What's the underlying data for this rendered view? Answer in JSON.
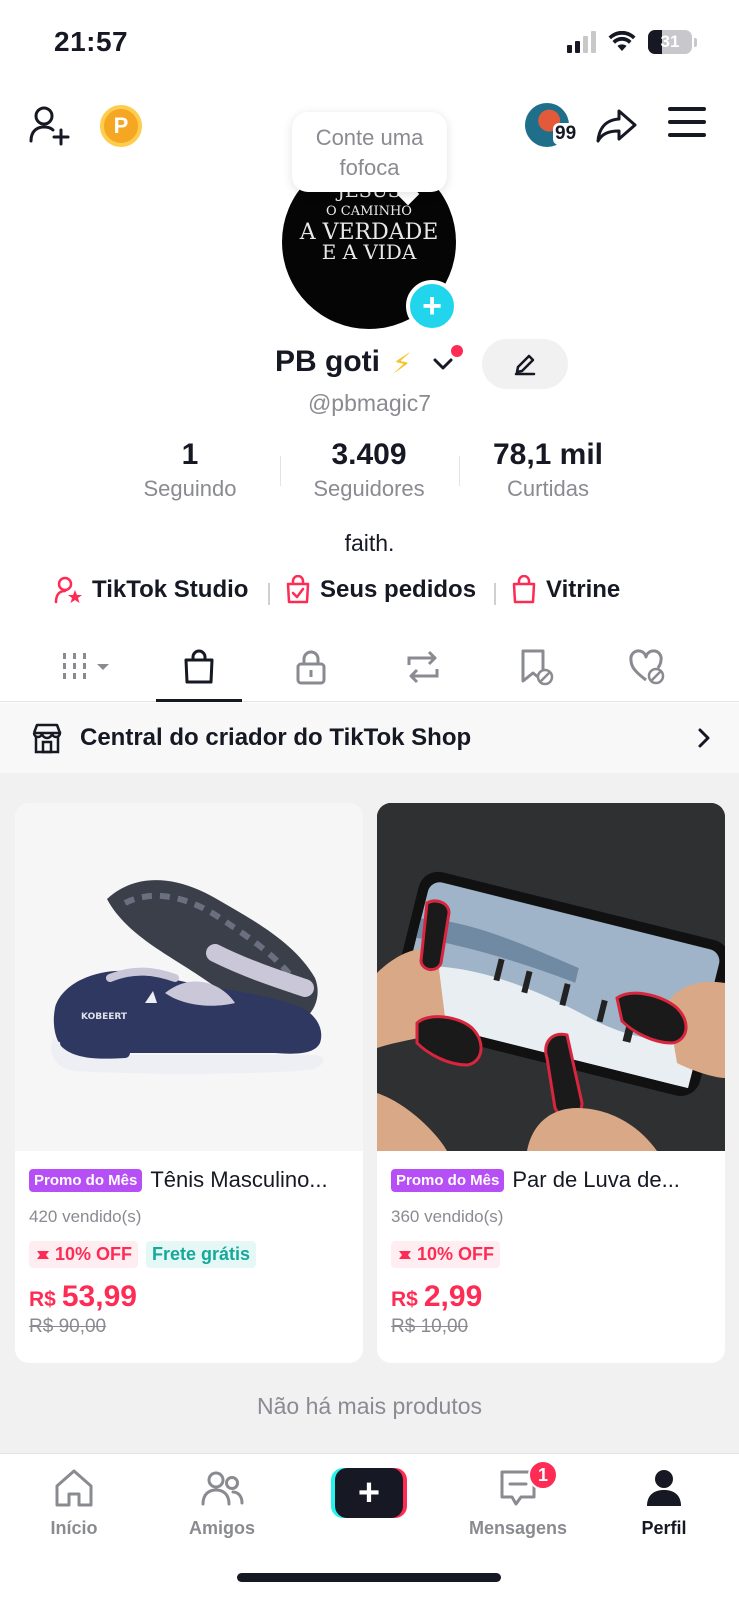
{
  "status_bar": {
    "time": "21:57",
    "battery": "31"
  },
  "profile": {
    "tooltip": "Conte uma fofoca",
    "story_count": "99",
    "display_name": "PB goti",
    "name_emoji": "⚡",
    "username": "@pbmagic7",
    "avatar_text": [
      "JESUS",
      "O CAMINHO",
      "A VERDADE",
      "E A VIDA"
    ],
    "bio": "faith."
  },
  "stats": [
    {
      "value": "1",
      "label": "Seguindo"
    },
    {
      "value": "3.409",
      "label": "Seguidores"
    },
    {
      "value": "78,1 mil",
      "label": "Curtidas"
    }
  ],
  "links": [
    {
      "label": "TikTok Studio",
      "icon": "studio-icon"
    },
    {
      "label": "Seus pedidos",
      "icon": "orders-icon"
    },
    {
      "label": "Vitrine",
      "icon": "showcase-icon"
    }
  ],
  "tabs": [
    "videos-grid",
    "shop",
    "private",
    "reposts",
    "favorites",
    "liked"
  ],
  "active_tab": "shop",
  "shop_header": {
    "label": "Central do criador do TikTok Shop"
  },
  "products": [
    {
      "promo": "Promo do Mês",
      "title": "Tênis Masculino...",
      "sold": "420 vendido(s)",
      "discount": "10% OFF",
      "shipping": "Frete grátis",
      "currency": "R$",
      "price": "53,99",
      "old_price": "R$ 90,00",
      "image_text": "KOBEERT"
    },
    {
      "promo": "Promo do Mês",
      "title": "Par de Luva de...",
      "sold": "360 vendido(s)",
      "discount": "10% OFF",
      "currency": "R$",
      "price": "2,99",
      "old_price": "R$ 10,00"
    }
  ],
  "no_more": "Não há mais produtos",
  "bottom_nav": [
    {
      "label": "Início"
    },
    {
      "label": "Amigos"
    },
    {
      "label": "Mensagens",
      "badge": "1"
    },
    {
      "label": "Perfil"
    }
  ],
  "colors": {
    "accent": "#fe2c55",
    "cyan": "#25f4ee",
    "promo": "#b64ff5",
    "text": "#161823",
    "muted": "#8a8b91"
  }
}
